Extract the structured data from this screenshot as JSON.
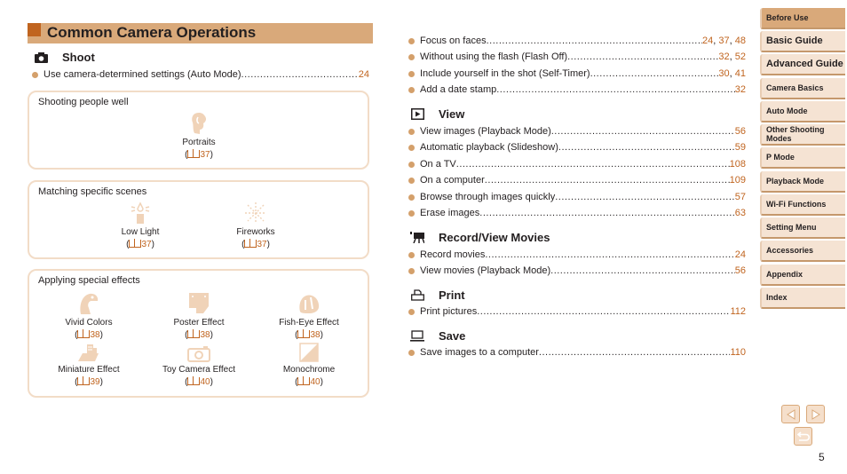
{
  "page": {
    "title": "Common Camera Operations",
    "page_number": "5",
    "colors": {
      "accent": "#c0641f",
      "title_bar": "#d9a97a",
      "bullet": "#d4a06b",
      "box_border": "#f2dcc7",
      "tab_bg": "#f5e3d3"
    }
  },
  "shoot": {
    "heading": "Shoot",
    "icon": "camera-icon",
    "items": [
      {
        "label": "Use camera-determined settings (Auto Mode)",
        "pages": [
          "24"
        ]
      }
    ],
    "boxes": [
      {
        "title": "Shooting people well",
        "cells": [
          {
            "label": "Portraits",
            "page": "37",
            "icon": "portrait-icon"
          }
        ]
      },
      {
        "title": "Matching specific scenes",
        "cells": [
          {
            "label": "Low Light",
            "page": "37",
            "icon": "low-light-icon"
          },
          {
            "label": "Fireworks",
            "page": "37",
            "icon": "fireworks-icon"
          }
        ]
      },
      {
        "title": "Applying special effects",
        "cells": [
          {
            "label": "Vivid Colors",
            "page": "38",
            "icon": "vivid-colors-icon"
          },
          {
            "label": "Poster Effect",
            "page": "38",
            "icon": "poster-effect-icon"
          },
          {
            "label": "Fish-Eye Effect",
            "page": "38",
            "icon": "fish-eye-icon"
          },
          {
            "label": "Miniature Effect",
            "page": "39",
            "icon": "miniature-icon"
          },
          {
            "label": "Toy Camera Effect",
            "page": "40",
            "icon": "toy-camera-icon"
          },
          {
            "label": "Monochrome",
            "page": "40",
            "icon": "monochrome-icon"
          }
        ]
      }
    ]
  },
  "shoot_more": {
    "items": [
      {
        "label": "Focus on faces",
        "pages": [
          "24",
          "37",
          "48"
        ]
      },
      {
        "label": "Without using the flash (Flash Off)",
        "pages": [
          "32",
          "52"
        ]
      },
      {
        "label": "Include yourself in the shot (Self-Timer)",
        "pages": [
          "30",
          "41"
        ]
      },
      {
        "label": "Add a date stamp",
        "pages": [
          "32"
        ]
      }
    ]
  },
  "view": {
    "heading": "View",
    "icon": "playback-icon",
    "items": [
      {
        "label": "View images (Playback Mode)",
        "pages": [
          "56"
        ]
      },
      {
        "label": "Automatic playback (Slideshow)",
        "pages": [
          "59"
        ]
      },
      {
        "label": "On a TV",
        "pages": [
          "108"
        ]
      },
      {
        "label": "On a computer",
        "pages": [
          "109"
        ]
      },
      {
        "label": "Browse through images quickly",
        "pages": [
          "57"
        ]
      },
      {
        "label": "Erase images",
        "pages": [
          "63"
        ]
      }
    ]
  },
  "movies": {
    "heading": "Record/View Movies",
    "icon": "movie-camera-icon",
    "items": [
      {
        "label": "Record movies",
        "pages": [
          "24"
        ]
      },
      {
        "label": "View movies (Playback Mode)",
        "pages": [
          "56"
        ]
      }
    ]
  },
  "print": {
    "heading": "Print",
    "icon": "printer-icon",
    "items": [
      {
        "label": "Print pictures",
        "pages": [
          "112"
        ]
      }
    ]
  },
  "save": {
    "heading": "Save",
    "icon": "laptop-icon",
    "items": [
      {
        "label": "Save images to a computer",
        "pages": [
          "110"
        ]
      }
    ]
  },
  "sidebar": {
    "tabs": [
      {
        "label": "Before Use",
        "active": true
      },
      {
        "label": "Basic Guide"
      },
      {
        "label": "Advanced Guide"
      },
      {
        "label": "Camera Basics"
      },
      {
        "label": "Auto Mode"
      },
      {
        "label": "Other Shooting Modes"
      },
      {
        "label": "P Mode"
      },
      {
        "label": "Playback Mode"
      },
      {
        "label": "Wi-Fi Functions"
      },
      {
        "label": "Setting Menu"
      },
      {
        "label": "Accessories"
      },
      {
        "label": "Appendix"
      },
      {
        "label": "Index"
      }
    ]
  },
  "nav": {
    "prev": "previous-page",
    "next": "next-page",
    "back": "return"
  }
}
